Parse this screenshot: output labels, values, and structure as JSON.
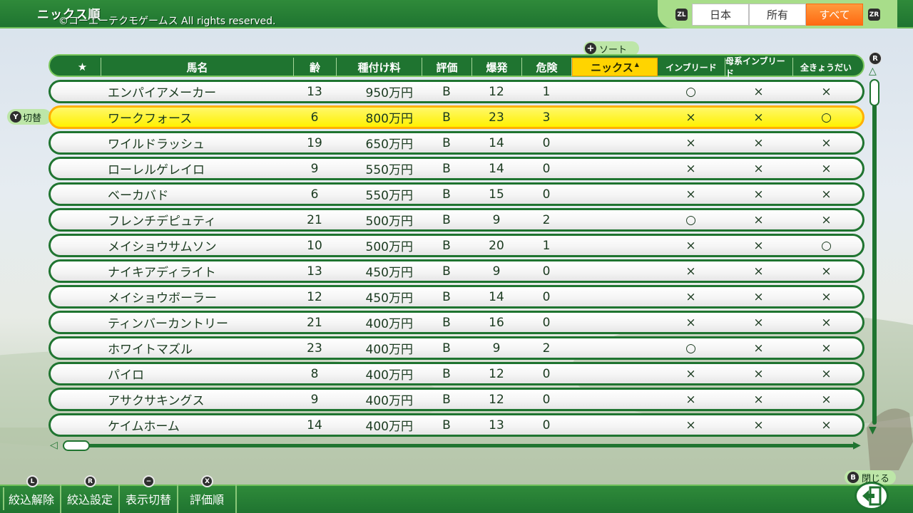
{
  "header": {
    "title": "ニックス順",
    "copyright": "©コーエーテクモゲームス All rights reserved.",
    "tabs": [
      {
        "label": "日本",
        "active": false
      },
      {
        "label": "所有",
        "active": false
      },
      {
        "label": "すべて",
        "active": true
      }
    ],
    "left_key": "ZL",
    "right_key": "ZR"
  },
  "sort_badge": {
    "label": "ソート",
    "key": "+"
  },
  "switch_badge": {
    "label": "切替",
    "key": "Y"
  },
  "table": {
    "columns": [
      "★",
      "馬名",
      "齢",
      "種付け料",
      "評価",
      "爆発",
      "危険",
      "ニックス",
      "インブリード",
      "母系インブリード",
      "全きょうだい"
    ],
    "sorted_column": "ニックス",
    "selected_row_index": 1,
    "rows": [
      {
        "name": "エンパイアメーカー",
        "age": "13",
        "fee": "950万円",
        "grade": "B",
        "burst": "12",
        "danger": "1",
        "inbreed": "○",
        "maternal": "×",
        "sibling": "×"
      },
      {
        "name": "ワークフォース",
        "age": "6",
        "fee": "800万円",
        "grade": "B",
        "burst": "23",
        "danger": "3",
        "inbreed": "×",
        "maternal": "×",
        "sibling": "○"
      },
      {
        "name": "ワイルドラッシュ",
        "age": "19",
        "fee": "650万円",
        "grade": "B",
        "burst": "14",
        "danger": "0",
        "inbreed": "×",
        "maternal": "×",
        "sibling": "×"
      },
      {
        "name": "ローレルゲレイロ",
        "age": "9",
        "fee": "550万円",
        "grade": "B",
        "burst": "14",
        "danger": "0",
        "inbreed": "×",
        "maternal": "×",
        "sibling": "×"
      },
      {
        "name": "ベーカバド",
        "age": "6",
        "fee": "550万円",
        "grade": "B",
        "burst": "15",
        "danger": "0",
        "inbreed": "×",
        "maternal": "×",
        "sibling": "×"
      },
      {
        "name": "フレンチデピュティ",
        "age": "21",
        "fee": "500万円",
        "grade": "B",
        "burst": "9",
        "danger": "2",
        "inbreed": "○",
        "maternal": "×",
        "sibling": "×"
      },
      {
        "name": "メイショウサムソン",
        "age": "10",
        "fee": "500万円",
        "grade": "B",
        "burst": "20",
        "danger": "1",
        "inbreed": "×",
        "maternal": "×",
        "sibling": "○"
      },
      {
        "name": "ナイキアディライト",
        "age": "13",
        "fee": "450万円",
        "grade": "B",
        "burst": "9",
        "danger": "0",
        "inbreed": "×",
        "maternal": "×",
        "sibling": "×"
      },
      {
        "name": "メイショウボーラー",
        "age": "12",
        "fee": "450万円",
        "grade": "B",
        "burst": "14",
        "danger": "0",
        "inbreed": "×",
        "maternal": "×",
        "sibling": "×"
      },
      {
        "name": "ティンバーカントリー",
        "age": "21",
        "fee": "400万円",
        "grade": "B",
        "burst": "16",
        "danger": "0",
        "inbreed": "×",
        "maternal": "×",
        "sibling": "×"
      },
      {
        "name": "ホワイトマズル",
        "age": "23",
        "fee": "400万円",
        "grade": "B",
        "burst": "9",
        "danger": "2",
        "inbreed": "○",
        "maternal": "×",
        "sibling": "×"
      },
      {
        "name": "パイロ",
        "age": "8",
        "fee": "400万円",
        "grade": "B",
        "burst": "12",
        "danger": "0",
        "inbreed": "×",
        "maternal": "×",
        "sibling": "×"
      },
      {
        "name": "アサクサキングス",
        "age": "9",
        "fee": "400万円",
        "grade": "B",
        "burst": "12",
        "danger": "0",
        "inbreed": "×",
        "maternal": "×",
        "sibling": "×"
      },
      {
        "name": "ケイムホーム",
        "age": "14",
        "fee": "400万円",
        "grade": "B",
        "burst": "13",
        "danger": "0",
        "inbreed": "×",
        "maternal": "×",
        "sibling": "×"
      }
    ]
  },
  "footer": {
    "buttons": [
      {
        "label": "絞込解除",
        "key": "L"
      },
      {
        "label": "絞込設定",
        "key": "R"
      },
      {
        "label": "表示切替",
        "key": "−"
      },
      {
        "label": "評価順",
        "key": "X"
      }
    ],
    "close": {
      "label": "閉じる",
      "key": "B"
    },
    "scroll_key": "R"
  },
  "colors": {
    "bar_green": "#1f7430",
    "selected_row": "#fff100",
    "active_tab": "#ff6a12",
    "sorted_header": "#ffd400"
  }
}
